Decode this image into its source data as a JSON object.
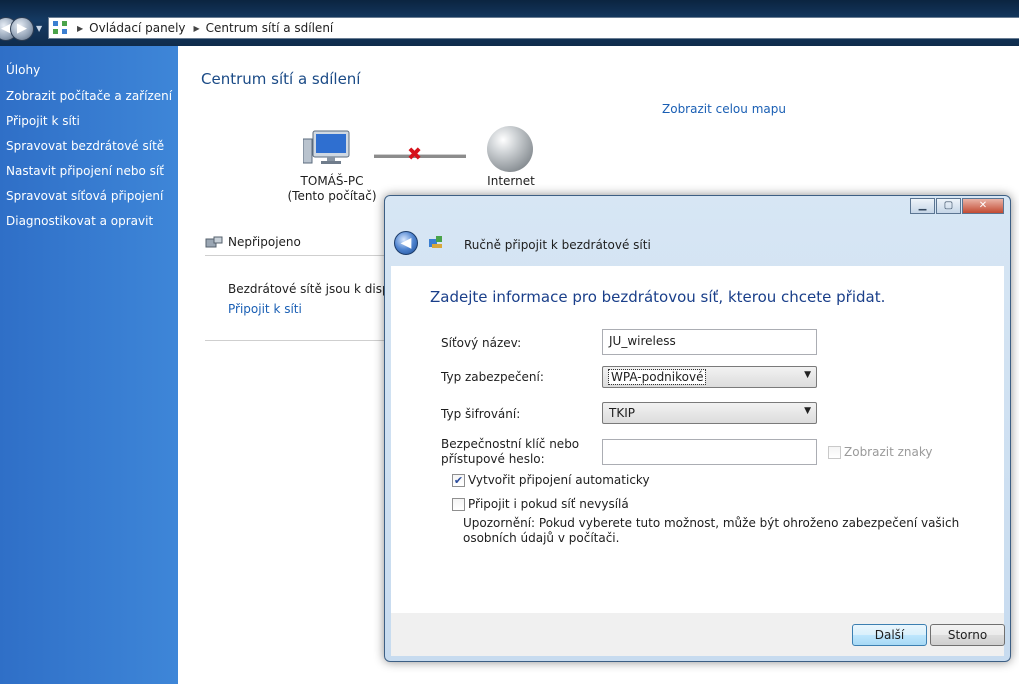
{
  "address_bar": {
    "crumbs": [
      "Ovládací panely",
      "Centrum sítí a sdílení"
    ]
  },
  "sidebar": {
    "heading": "Úlohy",
    "items": [
      {
        "label": "Zobrazit počítače a zařízení"
      },
      {
        "label": "Připojit k síti"
      },
      {
        "label": "Spravovat bezdrátové sítě"
      },
      {
        "label": "Nastavit připojení nebo síť"
      },
      {
        "label": "Spravovat síťová připojení"
      },
      {
        "label": "Diagnostikovat a opravit"
      }
    ]
  },
  "main": {
    "title": "Centrum sítí a sdílení",
    "map_link": "Zobrazit celou mapu",
    "computer_name": "TOMÁŠ-PC",
    "computer_sub": "(Tento počítač)",
    "internet_label": "Internet",
    "network_status": "Nepřipojeno",
    "wireless_text": "Bezdrátové sítě jsou k dispozici",
    "connect_link": "Připojit k síti"
  },
  "dialog": {
    "title": "Ručně připojit k bezdrátové síti",
    "instruction": "Zadejte informace pro bezdrátovou síť, kterou chcete přidat.",
    "network_name_label": "Síťový název:",
    "network_name_value": "JU_wireless",
    "security_type_label": "Typ zabezpečení:",
    "security_type_value": "WPA-podnikové",
    "encryption_type_label": "Typ šifrování:",
    "encryption_type_value": "TKIP",
    "key_label_line1": "Bezpečnostní klíč nebo",
    "key_label_line2": "přístupové heslo:",
    "key_value": "",
    "show_chars_label": "Zobrazit znaky",
    "auto_connect_label": "Vytvořit připojení automaticky",
    "auto_connect_checked": true,
    "connect_hidden_label": "Připojit i pokud síť nevysílá",
    "connect_hidden_checked": false,
    "warning_text": "Upozornění: Pokud vyberete tuto možnost, může být ohroženo zabezpečení vašich osobních údajů v počítači.",
    "next_button": "Další",
    "cancel_button": "Storno"
  },
  "colors": {
    "sidebar": "#3a7fd5",
    "link": "#1a5fb4",
    "title": "#1a4a86",
    "error_x": "#d6121b"
  }
}
